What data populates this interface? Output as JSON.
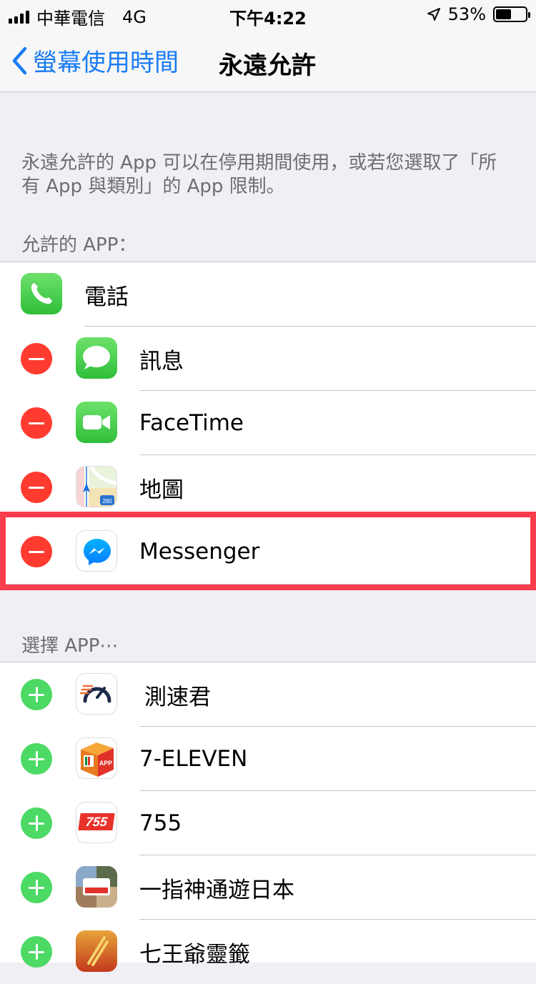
{
  "status_bar": {
    "carrier": "中華電信",
    "network": "4G",
    "time": "下午4:22",
    "battery": "53%",
    "battery_level": 0.53
  },
  "nav": {
    "back_label": "螢幕使用時間",
    "title": "永遠允許"
  },
  "description": "永遠允許的 App 可以在停用期間使用，或若您選取了「所有 App 與類別」的 App 限制。",
  "allowed_section": {
    "header": "允許的 APP：",
    "items": [
      {
        "label": "電話",
        "icon": "phone-icon"
      },
      {
        "label": "訊息",
        "icon": "messages-icon"
      },
      {
        "label": "FaceTime",
        "icon": "facetime-icon"
      },
      {
        "label": "地圖",
        "icon": "maps-icon"
      },
      {
        "label": "Messenger",
        "icon": "messenger-icon"
      }
    ]
  },
  "choose_section": {
    "header": "選擇 APP⋯",
    "items": [
      {
        "label": "測速君",
        "icon": "speedtest-icon"
      },
      {
        "label": "7-ELEVEN",
        "icon": "seven-eleven-icon"
      },
      {
        "label": "755",
        "icon": "app-755-icon",
        "icon_text": "755"
      },
      {
        "label": "一指神通遊日本",
        "icon": "japan-travel-icon"
      },
      {
        "label": "七王爺靈籤",
        "icon": "fortune-sticks-icon"
      }
    ]
  },
  "colors": {
    "accent": "#1a7cf5",
    "remove": "#ff3b30",
    "add": "#4cd964",
    "highlight": "#fa3c4c",
    "background": "#efeff4"
  }
}
